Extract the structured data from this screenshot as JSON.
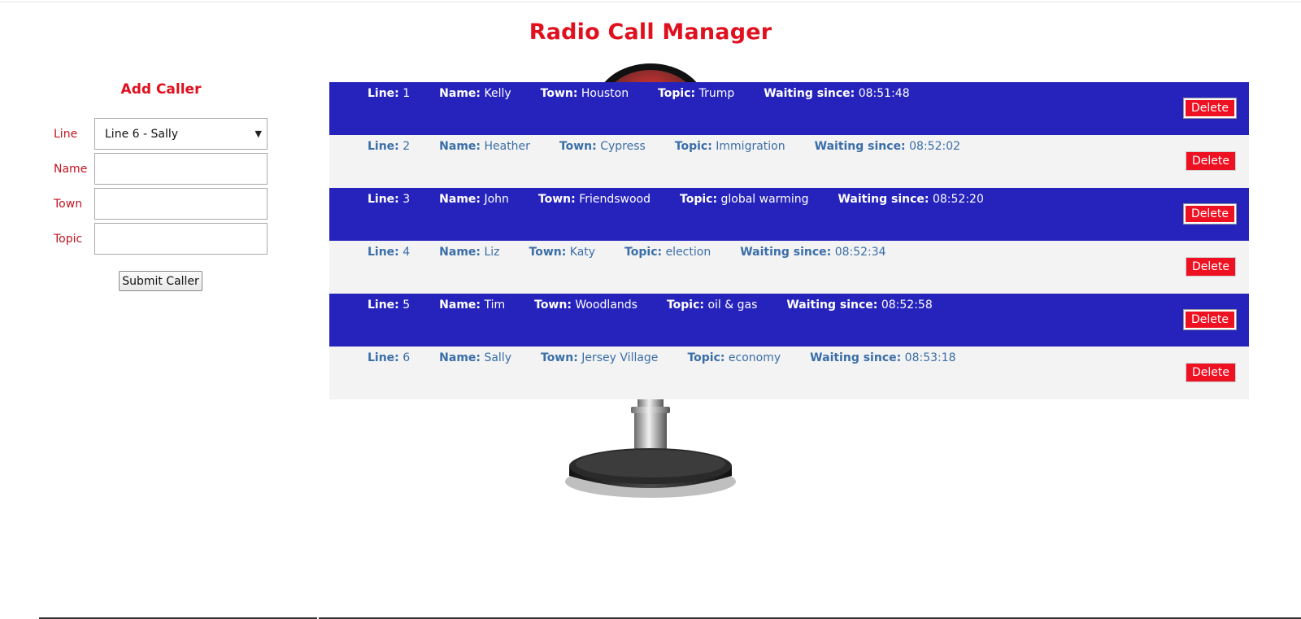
{
  "page": {
    "title": "Radio Call Manager"
  },
  "form": {
    "title": "Add Caller",
    "line_label": "Line",
    "line_selected": "Line 6 - Sally",
    "name_label": "Name",
    "name_value": "",
    "town_label": "Town",
    "town_value": "",
    "topic_label": "Topic",
    "topic_value": "",
    "submit_label": "Submit Caller"
  },
  "field_labels": {
    "line": "Line:",
    "name": "Name:",
    "town": "Town:",
    "topic": "Topic:",
    "waiting": "Waiting since:"
  },
  "delete_label": "Delete",
  "calls": [
    {
      "line": "1",
      "name": "Kelly",
      "town": "Houston",
      "topic": "Trump",
      "waiting": "08:51:48",
      "style": "dark"
    },
    {
      "line": "2",
      "name": "Heather",
      "town": "Cypress",
      "topic": "Immigration",
      "waiting": "08:52:02",
      "style": "light"
    },
    {
      "line": "3",
      "name": "John",
      "town": "Friendswood",
      "topic": "global warming",
      "waiting": "08:52:20",
      "style": "dark"
    },
    {
      "line": "4",
      "name": "Liz",
      "town": "Katy",
      "topic": "election",
      "waiting": "08:52:34",
      "style": "light"
    },
    {
      "line": "5",
      "name": "Tim",
      "town": "Woodlands",
      "topic": "oil & gas",
      "waiting": "08:52:58",
      "style": "dark"
    },
    {
      "line": "6",
      "name": "Sally",
      "town": "Jersey Village",
      "topic": "economy",
      "waiting": "08:53:18",
      "style": "light"
    }
  ],
  "colors": {
    "accent_red": "#e0101e",
    "row_dark": "#2623bd",
    "row_light": "#f3f3f3",
    "light_text": "#3a6ea8",
    "delete_red": "#ee1122"
  },
  "icons": {
    "background": "microphone-icon"
  }
}
